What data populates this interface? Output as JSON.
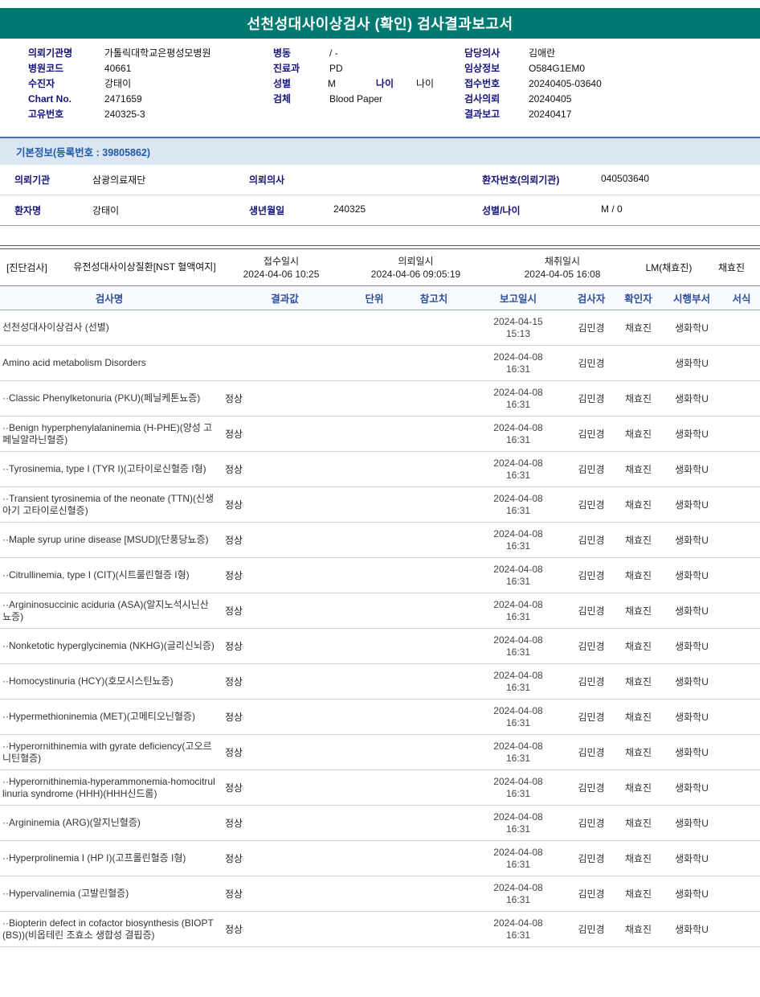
{
  "title": "선천성대사이상검사 (확인) 검사결과보고서",
  "colors": {
    "title_bar": "#007970",
    "header_label": "#14147a",
    "section_bg": "#dce6f2",
    "section_text": "#1f5aa8",
    "table_header_text": "#2c4f9e"
  },
  "header": {
    "left": [
      {
        "label": "의뢰기관명",
        "value": "가톨릭대학교은평성모병원",
        "label2": "",
        "value2": ""
      },
      {
        "label": "병원코드",
        "value": "40661",
        "label2": "",
        "value2": ""
      },
      {
        "label": "수진자",
        "value": "강태이",
        "label2": "",
        "value2": ""
      },
      {
        "label": "Chart No.",
        "value": "2471659",
        "label2": "",
        "value2": ""
      },
      {
        "label": "고유번호",
        "value": "240325-3",
        "label2": "",
        "value2": ""
      }
    ],
    "middle": [
      {
        "label": "병동",
        "value": "/ -",
        "label2": "",
        "value2": ""
      },
      {
        "label": "진료과",
        "value": "PD",
        "label2": "",
        "value2": ""
      },
      {
        "label": "성별",
        "value": "M",
        "label2": "나이",
        "value2": "나이"
      },
      {
        "label": "검체",
        "value": "Blood Paper",
        "label2": "",
        "value2": ""
      }
    ],
    "right": [
      {
        "label": "담당의사",
        "value": "김애란",
        "label2": "",
        "value2": ""
      },
      {
        "label": "임상정보",
        "value": "O584G1EM0",
        "label2": "",
        "value2": ""
      },
      {
        "label": "접수번호",
        "value": "20240405-03640",
        "label2": "",
        "value2": ""
      },
      {
        "label": "검사의뢰",
        "value": "20240405",
        "label2": "",
        "value2": ""
      },
      {
        "label": "결과보고",
        "value": "20240417",
        "label2": "",
        "value2": ""
      }
    ]
  },
  "basic_info": {
    "title": "기본정보(등록번호 : 39805862)",
    "rows": [
      [
        {
          "label": "의뢰기관",
          "value": "삼광의료재단"
        },
        {
          "label": "의뢰의사",
          "value": ""
        },
        {
          "label": "환자번호(의뢰기관)",
          "value": "040503640"
        }
      ],
      [
        {
          "label": "환자명",
          "value": "강태이"
        },
        {
          "label": "생년월일",
          "value": "240325"
        },
        {
          "label": "성별/나이",
          "value": "M / 0"
        }
      ]
    ]
  },
  "diagnostic": {
    "tag": "[진단검사]",
    "test_name": "유전성대사이상질환[NST 혈액여지]",
    "columns": [
      {
        "label": "접수일시",
        "value": "2024-04-06 10:25"
      },
      {
        "label": "의뢰일시",
        "value": "2024-04-06 09:05:19"
      },
      {
        "label": "채취일시",
        "value": "2024-04-05 16:08"
      }
    ],
    "collector": "LM(채효진)",
    "nurse": "채효진"
  },
  "results_table": {
    "headers": [
      "검사명",
      "결과값",
      "단위",
      "참고치",
      "보고일시",
      "검사자",
      "확인자",
      "시행부서",
      "서식"
    ],
    "rows": [
      {
        "name": "선천성대사이상검사 (선별)",
        "result": "",
        "unit": "",
        "ref": "",
        "report_date": "2024-04-15",
        "report_time": "15:13",
        "tester": "김민경",
        "confirmer": "채효진",
        "dept": "생화학U",
        "form": ""
      },
      {
        "name": "Amino acid metabolism Disorders",
        "result": "",
        "unit": "",
        "ref": "",
        "report_date": "2024-04-08",
        "report_time": "16:31",
        "tester": "김민경",
        "confirmer": "",
        "dept": "생화학U",
        "form": ""
      },
      {
        "name": "··Classic Phenylketonuria (PKU)(페닐케톤뇨증)",
        "result": "정상",
        "unit": "",
        "ref": "",
        "report_date": "2024-04-08",
        "report_time": "16:31",
        "tester": "김민경",
        "confirmer": "채효진",
        "dept": "생화학U",
        "form": ""
      },
      {
        "name": "··Benign hyperphenylalaninemia (H-PHE)(양성 고페닐알라닌혈증)",
        "result": "정상",
        "unit": "",
        "ref": "",
        "report_date": "2024-04-08",
        "report_time": "16:31",
        "tester": "김민경",
        "confirmer": "채효진",
        "dept": "생화학U",
        "form": ""
      },
      {
        "name": "··Tyrosinemia, type I (TYR I)(고타이로신혈증 I형)",
        "result": "정상",
        "unit": "",
        "ref": "",
        "report_date": "2024-04-08",
        "report_time": "16:31",
        "tester": "김민경",
        "confirmer": "채효진",
        "dept": "생화학U",
        "form": ""
      },
      {
        "name": "··Transient tyrosinemia of the neonate (TTN)(신생아기 고타이로신혈증)",
        "result": "정상",
        "unit": "",
        "ref": "",
        "report_date": "2024-04-08",
        "report_time": "16:31",
        "tester": "김민경",
        "confirmer": "채효진",
        "dept": "생화학U",
        "form": ""
      },
      {
        "name": "··Maple syrup urine disease [MSUD](단풍당뇨증)",
        "result": "정상",
        "unit": "",
        "ref": "",
        "report_date": "2024-04-08",
        "report_time": "16:31",
        "tester": "김민경",
        "confirmer": "채효진",
        "dept": "생화학U",
        "form": ""
      },
      {
        "name": "··Citrullinemia, type I (CIT)(시트룰린혈증 I형)",
        "result": "정상",
        "unit": "",
        "ref": "",
        "report_date": "2024-04-08",
        "report_time": "16:31",
        "tester": "김민경",
        "confirmer": "채효진",
        "dept": "생화학U",
        "form": ""
      },
      {
        "name": "··Argininosuccinic aciduria (ASA)(알지노석시닌산뇨증)",
        "result": "정상",
        "unit": "",
        "ref": "",
        "report_date": "2024-04-08",
        "report_time": "16:31",
        "tester": "김민경",
        "confirmer": "채효진",
        "dept": "생화학U",
        "form": ""
      },
      {
        "name": "··Nonketotic hyperglycinemia (NKHG)(글리신뇌증)",
        "result": "정상",
        "unit": "",
        "ref": "",
        "report_date": "2024-04-08",
        "report_time": "16:31",
        "tester": "김민경",
        "confirmer": "채효진",
        "dept": "생화학U",
        "form": ""
      },
      {
        "name": "··Homocystinuria (HCY)(호모시스틴뇨증)",
        "result": "정상",
        "unit": "",
        "ref": "",
        "report_date": "2024-04-08",
        "report_time": "16:31",
        "tester": "김민경",
        "confirmer": "채효진",
        "dept": "생화학U",
        "form": ""
      },
      {
        "name": "··Hypermethioninemia (MET)(고메티오닌혈증)",
        "result": "정상",
        "unit": "",
        "ref": "",
        "report_date": "2024-04-08",
        "report_time": "16:31",
        "tester": "김민경",
        "confirmer": "채효진",
        "dept": "생화학U",
        "form": ""
      },
      {
        "name": "··Hyperornithinemia with gyrate deficiency(고오르니틴혈증)",
        "result": "정상",
        "unit": "",
        "ref": "",
        "report_date": "2024-04-08",
        "report_time": "16:31",
        "tester": "김민경",
        "confirmer": "채효진",
        "dept": "생화학U",
        "form": ""
      },
      {
        "name": "··Hyperornithinemia-hyperammonemia-homocitrullinuria syndrome (HHH)(HHH신드롬)",
        "result": "정상",
        "unit": "",
        "ref": "",
        "report_date": "2024-04-08",
        "report_time": "16:31",
        "tester": "김민경",
        "confirmer": "채효진",
        "dept": "생화학U",
        "form": ""
      },
      {
        "name": "··Argininemia (ARG)(알지닌혈증)",
        "result": "정상",
        "unit": "",
        "ref": "",
        "report_date": "2024-04-08",
        "report_time": "16:31",
        "tester": "김민경",
        "confirmer": "채효진",
        "dept": "생화학U",
        "form": ""
      },
      {
        "name": "··Hyperprolinemia I (HP I)(고프롤린혈증 I형)",
        "result": "정상",
        "unit": "",
        "ref": "",
        "report_date": "2024-04-08",
        "report_time": "16:31",
        "tester": "김민경",
        "confirmer": "채효진",
        "dept": "생화학U",
        "form": ""
      },
      {
        "name": "··Hypervalinemia (고발린혈증)",
        "result": "정상",
        "unit": "",
        "ref": "",
        "report_date": "2024-04-08",
        "report_time": "16:31",
        "tester": "김민경",
        "confirmer": "채효진",
        "dept": "생화학U",
        "form": ""
      },
      {
        "name": "··Biopterin defect in cofactor biosynthesis (BIOPT(BS))(비옵테린 조효소 생합성 결핍증)",
        "result": "정상",
        "unit": "",
        "ref": "",
        "report_date": "2024-04-08",
        "report_time": "16:31",
        "tester": "김민경",
        "confirmer": "채효진",
        "dept": "생화학U",
        "form": ""
      }
    ]
  }
}
